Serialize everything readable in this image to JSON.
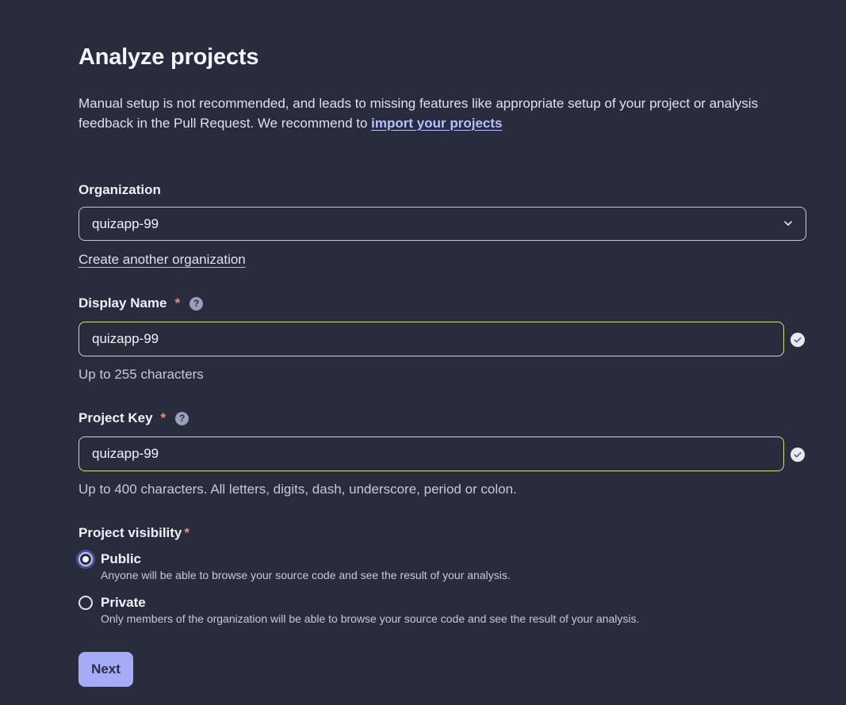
{
  "header": {
    "title": "Analyze projects"
  },
  "intro": {
    "text": "Manual setup is not recommended, and leads to missing features like appropriate setup of your project or analysis feedback in the Pull Request. We recommend to ",
    "link_label": "import your projects"
  },
  "organization": {
    "label": "Organization",
    "selected": "quizapp-99",
    "create_link": "Create another organization"
  },
  "display_name": {
    "label": "Display Name",
    "required_mark": "*",
    "help_glyph": "?",
    "value": "quizapp-99",
    "hint": "Up to 255 characters"
  },
  "project_key": {
    "label": "Project Key",
    "required_mark": "*",
    "help_glyph": "?",
    "value": "quizapp-99",
    "hint": "Up to 400 characters. All letters, digits, dash, underscore, period or colon."
  },
  "visibility": {
    "label": "Project visibility",
    "required_mark": "*",
    "selected": "public",
    "options": [
      {
        "title": "Public",
        "description": "Anyone will be able to browse your source code and see the result of your analysis."
      },
      {
        "title": "Private",
        "description": "Only members of the organization will be able to browse your source code and see the result of your analysis."
      }
    ]
  },
  "actions": {
    "next_label": "Next"
  },
  "icons": {
    "dropdown": "chevron-down-icon",
    "valid": "check-circle-icon",
    "help": "help-icon"
  },
  "colors": {
    "background": "#292c3d",
    "accent": "#a3acf5",
    "valid_border": "#c9e58a",
    "required": "#f08a7a",
    "link": "#b7c0ff"
  }
}
